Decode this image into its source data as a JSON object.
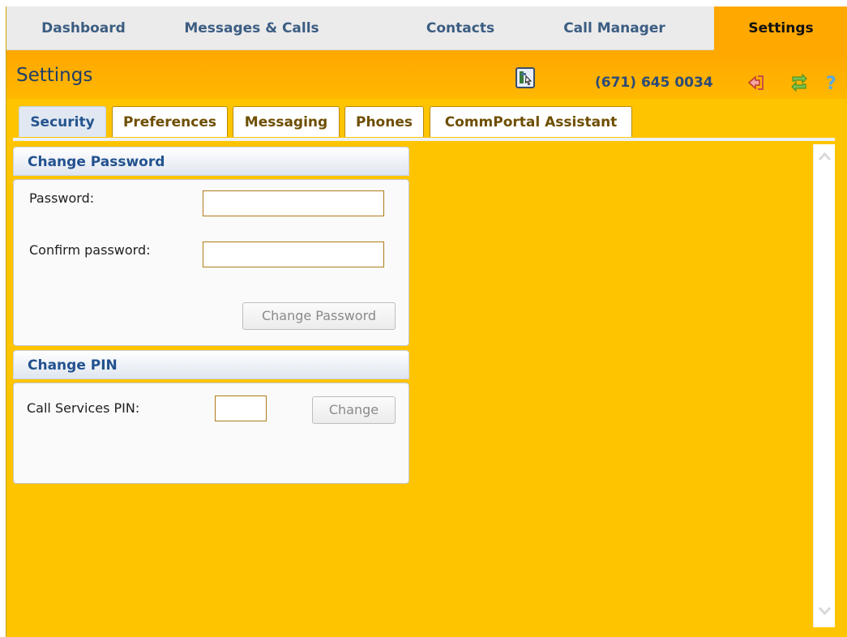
{
  "nav": {
    "items": [
      {
        "label": "Dashboard"
      },
      {
        "label": "Messages & Calls"
      },
      {
        "label": "Contacts"
      },
      {
        "label": "Call Manager"
      },
      {
        "label": "Settings"
      }
    ],
    "active": "Settings"
  },
  "header": {
    "title": "Settings",
    "phone_number": "(671) 645 0034",
    "icons": [
      "page-help-icon",
      "logout-icon",
      "refresh-icon",
      "help-icon"
    ]
  },
  "tabs": {
    "items": [
      {
        "label": "Security"
      },
      {
        "label": "Preferences"
      },
      {
        "label": "Messaging"
      },
      {
        "label": "Phones"
      },
      {
        "label": "CommPortal Assistant"
      }
    ],
    "active": "Security"
  },
  "change_password": {
    "title": "Change Password",
    "password_label": "Password:",
    "password_value": "",
    "confirm_label": "Confirm password:",
    "confirm_value": "",
    "button_label": "Change Password"
  },
  "change_pin": {
    "title": "Change PIN",
    "pin_label": "Call Services PIN:",
    "pin_value": "",
    "button_label": "Change"
  },
  "colors": {
    "background": "#ffc400",
    "header": "#ffa800",
    "accent": "#23528f"
  }
}
